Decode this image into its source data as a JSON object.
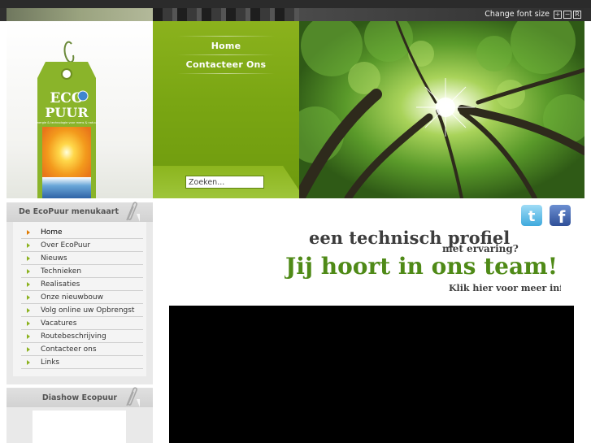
{
  "topbar": {
    "font_size_label": "Change font size",
    "buttons": [
      "+",
      "−",
      "R"
    ]
  },
  "logo": {
    "line1": "ECO",
    "line2": "PUUR",
    "tagline": "energie & technologie voor mens & natuur"
  },
  "nav": {
    "items": [
      "Home",
      "Contacteer Ons"
    ]
  },
  "search": {
    "value": "Zoeken..."
  },
  "sidebar": {
    "menu_title": "De EcoPuur menukaart",
    "items": [
      {
        "label": "Home",
        "active": true
      },
      {
        "label": "Over EcoPuur",
        "active": false
      },
      {
        "label": "Nieuws",
        "active": false
      },
      {
        "label": "Technieken",
        "active": false
      },
      {
        "label": "Realisaties",
        "active": false
      },
      {
        "label": "Onze nieuwbouw",
        "active": false
      },
      {
        "label": "Volg online uw Opbrengst",
        "active": false
      },
      {
        "label": "Vacatures",
        "active": false
      },
      {
        "label": "Routebeschrijving",
        "active": false
      },
      {
        "label": "Contacteer ons",
        "active": false
      },
      {
        "label": "Links",
        "active": false
      }
    ],
    "slideshow_title": "Diashow Ecopuur"
  },
  "social": {
    "twitter": "twitter-icon",
    "facebook": "facebook-icon"
  },
  "banner": {
    "line1": "een technisch profiel",
    "line2": "met ervaring?",
    "line3": "Jij hoort in ons team!",
    "line4": "Klik hier voor meer info"
  },
  "colors": {
    "nav_green": "#7aa613",
    "banner_green": "#4f8a17",
    "banner_dark": "#3d3d3d",
    "active_arrow": "#e07b00",
    "arrow": "#8cb21f"
  }
}
